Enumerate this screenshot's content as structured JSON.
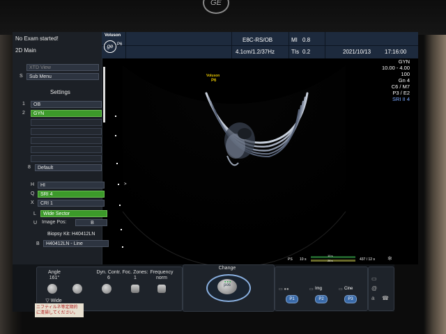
{
  "status": {
    "exam": "No Exam started!",
    "mode": "2D Main"
  },
  "header": {
    "brand": "Voluson",
    "model": "P6",
    "probe": "E8C-RS/OB",
    "mi_label": "MI",
    "mi_value": "0.8",
    "depth": "4.1cm/1.2/37Hz",
    "tis_label": "TIs",
    "tis_value": "0.2",
    "date": "2021/10/13",
    "time": "17:16:00"
  },
  "left_menu": {
    "xtd_view": "XTD View",
    "sub_menu_key": "S",
    "sub_menu": "Sub Menu",
    "settings_title": "Settings",
    "settings": [
      {
        "key": "1",
        "label": "OB",
        "active": false
      },
      {
        "key": "2",
        "label": "GYN",
        "active": true
      }
    ],
    "default_key": "8",
    "default_label": "Default",
    "h_key": "H",
    "h_label": "HI",
    "q_key": "Q",
    "q_label": "SRI 4",
    "x_key": "X",
    "x_label": "CRI 1",
    "l_key": "L",
    "l_label": "Wide Sector",
    "u_key": "U",
    "u_label": "Image Pos:",
    "u_value": "B",
    "biopsy_title": "Biopsy Kit: H40412LN",
    "b_key": "B",
    "b_label": "H40412LN - Line"
  },
  "image": {
    "brand": "Voluson",
    "model": "P6"
  },
  "params": [
    "GYN",
    "10.00 - 4.00",
    "100",
    "Gn   4",
    "C6 / M7",
    "P3 / E2",
    "SRI II 4"
  ],
  "cine": {
    "ps": "PS",
    "t1": "10 s",
    "t2": "10 s",
    "t3": "26 s",
    "frame": "437 / 12 s"
  },
  "bottom": {
    "angle_label": "Angle",
    "angle_value": "161°",
    "wide_label": "Wide",
    "dyn_label": "Dyn. Contr.",
    "dyn_value": "6",
    "foc_label": "Foc. Zones:",
    "foc_value": "1",
    "freq_label": "Frequency",
    "freq_value": "norm",
    "change_label": "Change",
    "center_label": "pos",
    "img_label": "Img",
    "cine_label": "Cine",
    "p1": "P1",
    "p2": "P2",
    "p3": "P3"
  },
  "sticker": {
    "line1": "ニフティルネ等定期的",
    "line2": "に清掃してください。"
  }
}
